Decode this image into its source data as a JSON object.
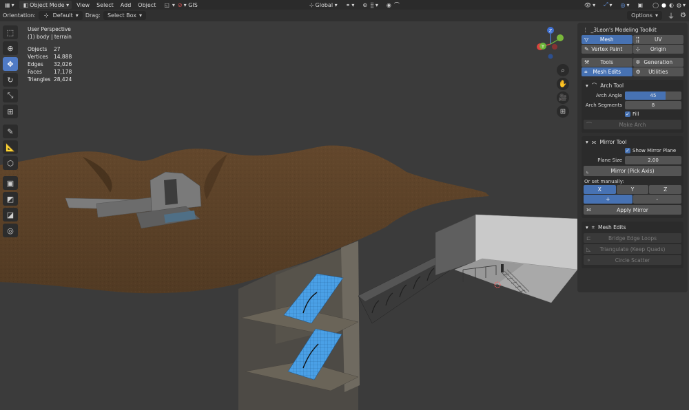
{
  "header": {
    "mode_label": "Object Mode",
    "menus": [
      "View",
      "Select",
      "Add",
      "Object"
    ],
    "gis_label": "GIS",
    "orientation_global": "Global"
  },
  "toolsettings": {
    "orientation_label": "Orientation:",
    "orientation_value": "Default",
    "drag_label": "Drag:",
    "drag_value": "Select Box",
    "options_label": "Options"
  },
  "viewport": {
    "perspective": "User Perspective",
    "object_name": "(1) body | terrain",
    "stats": [
      {
        "label": "Objects",
        "value": "27"
      },
      {
        "label": "Vertices",
        "value": "14,888"
      },
      {
        "label": "Edges",
        "value": "32,026"
      },
      {
        "label": "Faces",
        "value": "17,178"
      },
      {
        "label": "Triangles",
        "value": "28,424"
      }
    ],
    "gizmo": {
      "x": "X",
      "y": "Y",
      "z": "Z"
    }
  },
  "toolbar": {
    "tools": [
      "select-box-icon",
      "cursor-icon",
      "move-icon",
      "rotate-icon",
      "scale-icon",
      "transform-icon",
      "annotate-icon",
      "measure-icon",
      "add-cube-icon"
    ]
  },
  "npanel": {
    "title": "_3Leon's Modeling Toolkit",
    "mode_buttons": [
      "Mesh",
      "UV",
      "Vertex Paint",
      "Origin"
    ],
    "category_buttons": [
      "Tools",
      "Generation",
      "Mesh Edits",
      "Utilities"
    ],
    "arch": {
      "title": "Arch Tool",
      "angle_label": "Arch Angle",
      "angle_value": "45",
      "angle_fraction": 0.72,
      "segments_label": "Arch Segments",
      "segments_value": "8",
      "fill_label": "Fill",
      "make_label": "Make Arch"
    },
    "mirror": {
      "title": "Mirror Tool",
      "show_plane_label": "Show Mirror Plane",
      "plane_size_label": "Plane Size",
      "plane_size_value": "2.00",
      "pick_axis_label": "Mirror (Pick Axis)",
      "manual_label": "Or set manually:",
      "axes": [
        "X",
        "Y",
        "Z"
      ],
      "signs": [
        "+",
        "-"
      ],
      "apply_label": "Apply Mirror"
    },
    "mesh_edits": {
      "title": "Mesh Edits",
      "buttons": [
        "Bridge Edge Loops",
        "Triangulate (Keep Quads)",
        "Circle Scatter"
      ]
    }
  },
  "colors": {
    "accent": "#4772b3",
    "terrain": "#5a4128",
    "water": "#3f8fd6"
  }
}
